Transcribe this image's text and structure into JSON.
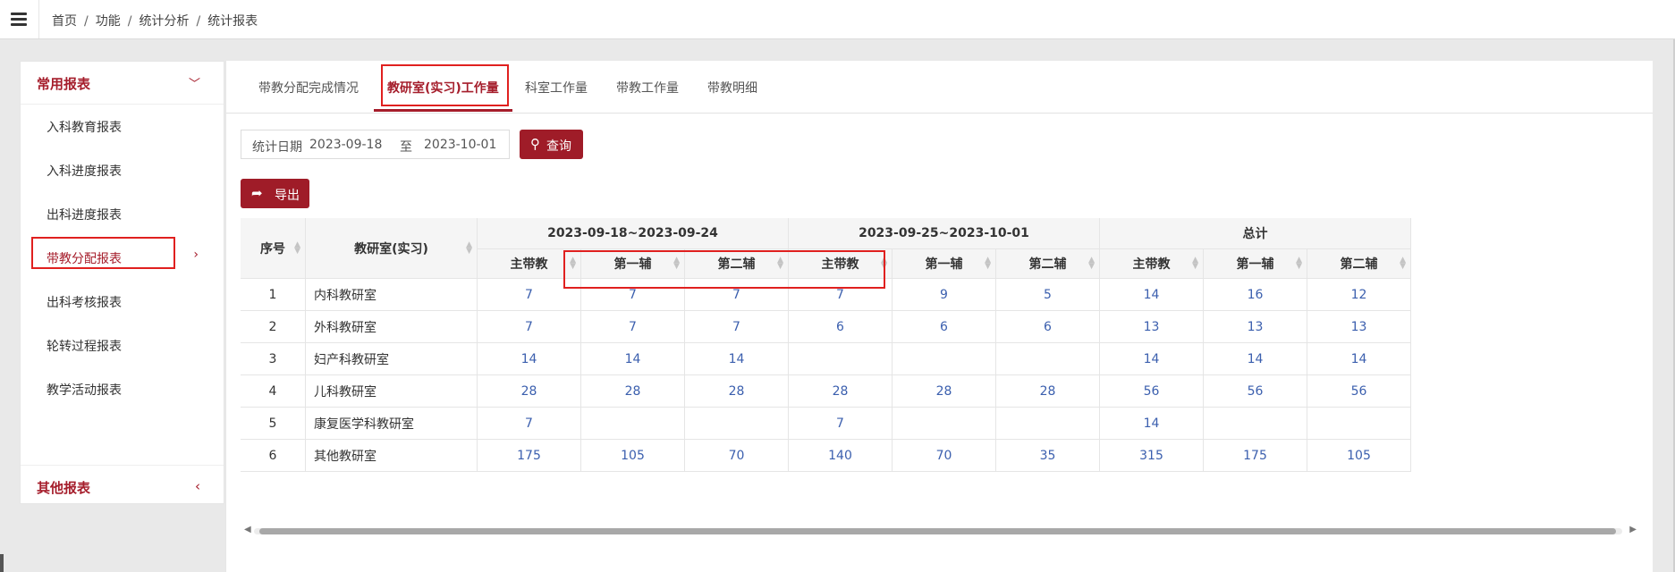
{
  "breadcrumb": [
    "首页",
    "功能",
    "统计分析",
    "统计报表"
  ],
  "sidebar": {
    "common_label": "常用报表",
    "items": [
      "入科教育报表",
      "入科进度报表",
      "出科进度报表",
      "带教分配报表",
      "出科考核报表",
      "轮转过程报表",
      "教学活动报表"
    ],
    "other_label": "其他报表"
  },
  "tabs": [
    "带教分配完成情况",
    "教研室(实习)工作量",
    "科室工作量",
    "带教工作量",
    "带教明细"
  ],
  "filter": {
    "date_label": "统计日期",
    "start_date": "2023-09-18",
    "to_label": "至",
    "end_date": "2023-10-01",
    "query_label": "查询",
    "export_label": "导出"
  },
  "table": {
    "col_index": "序号",
    "col_dept": "教研室(实习)",
    "groups": [
      "2023-09-18~2023-09-24",
      "2023-09-25~2023-10-01",
      "总计"
    ],
    "sub_columns": [
      "主带教",
      "第一辅",
      "第二辅"
    ],
    "rows": [
      {
        "no": "1",
        "name": "内科教研室",
        "v": [
          "7",
          "7",
          "7",
          "7",
          "9",
          "5",
          "14",
          "16",
          "12"
        ]
      },
      {
        "no": "2",
        "name": "外科教研室",
        "v": [
          "7",
          "7",
          "7",
          "6",
          "6",
          "6",
          "13",
          "13",
          "13"
        ]
      },
      {
        "no": "3",
        "name": "妇产科教研室",
        "v": [
          "14",
          "14",
          "14",
          "",
          "",
          "",
          "14",
          "14",
          "14"
        ]
      },
      {
        "no": "4",
        "name": "儿科教研室",
        "v": [
          "28",
          "28",
          "28",
          "28",
          "28",
          "28",
          "56",
          "56",
          "56"
        ]
      },
      {
        "no": "5",
        "name": "康复医学科教研室",
        "v": [
          "7",
          "",
          "",
          "7",
          "",
          "",
          "14",
          "",
          ""
        ]
      },
      {
        "no": "6",
        "name": "其他教研室",
        "v": [
          "175",
          "105",
          "70",
          "140",
          "70",
          "35",
          "315",
          "175",
          "105"
        ]
      }
    ]
  }
}
